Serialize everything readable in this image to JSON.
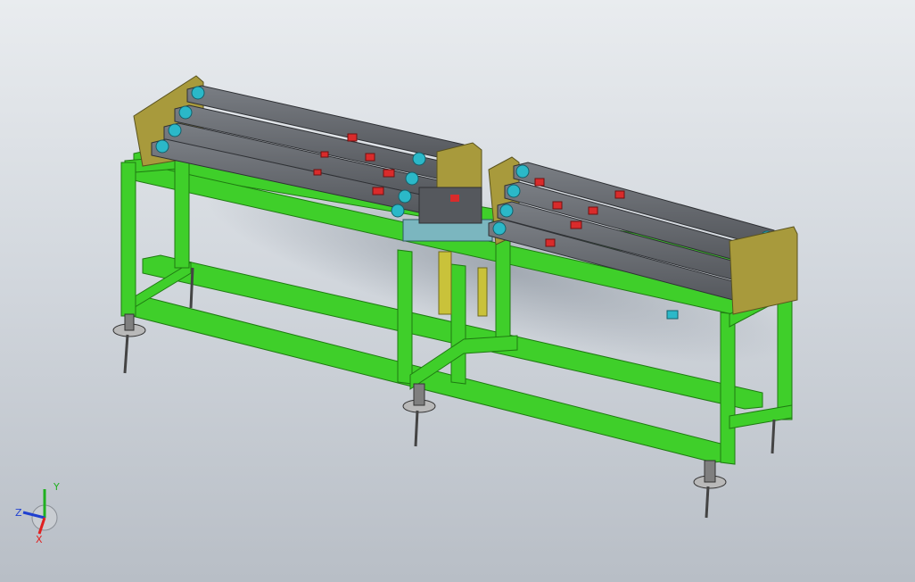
{
  "viewport": {
    "background_top": "#e9ecef",
    "background_bottom": "#b8bec6"
  },
  "colors": {
    "frame_green": "#3fcf2a",
    "frame_green_dark": "#229a14",
    "conveyor_gray": "#6e7278",
    "conveyor_dark": "#45484d",
    "accent_red": "#d92b2b",
    "accent_cyan": "#2bb8c8",
    "olive_plate": "#a89a3c",
    "support_yellow": "#c9c23a"
  },
  "triad": {
    "x_label": "X",
    "y_label": "Y",
    "z_label": "Z",
    "x_color": "#e02020",
    "y_color": "#20b020",
    "z_color": "#2040d0"
  },
  "icons": [
    "view-triad-icon"
  ]
}
